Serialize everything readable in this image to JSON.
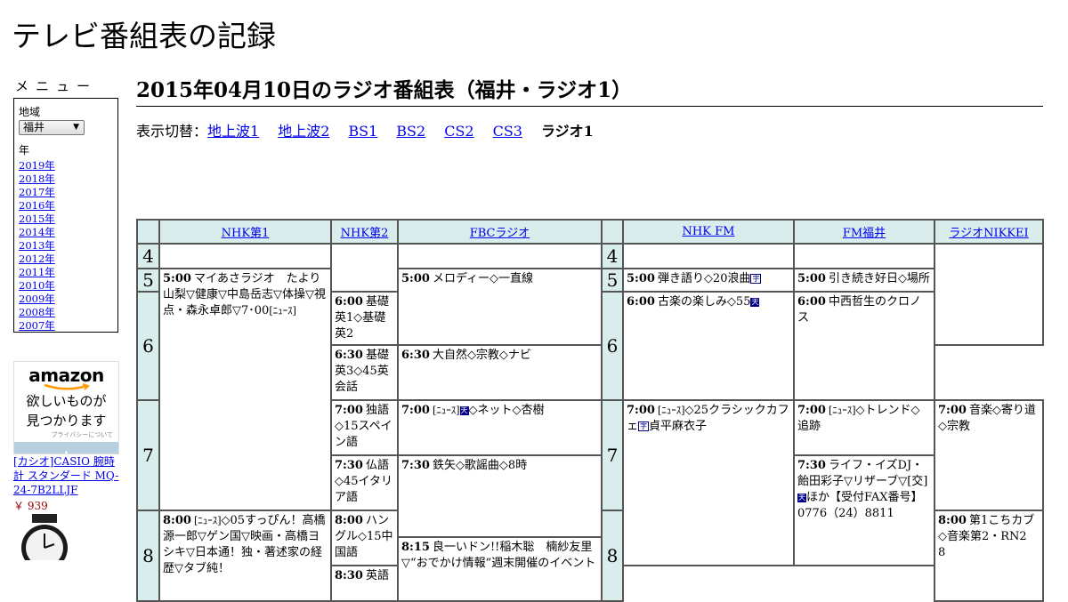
{
  "site": {
    "title": "テレビ番組表の記録"
  },
  "menu": {
    "title": "メニュー",
    "region_label": "地域",
    "region_value": "福井",
    "year_label": "年",
    "years": [
      "2019年",
      "2018年",
      "2017年",
      "2016年",
      "2015年",
      "2014年",
      "2013年",
      "2012年",
      "2011年",
      "2010年",
      "2009年",
      "2008年",
      "2007年"
    ]
  },
  "ad": {
    "logo": "amazon",
    "line1": "欲しいものが",
    "line2": "見つかります",
    "privacy": "プライバシーについて",
    "product_title": "[カシオ]CASIO 腕時計 スタンダード MQ-24-7B2LLJF",
    "price": "￥ 939"
  },
  "page": {
    "heading": "2015年04月10日のラジオ番組表（福井・ラジオ1）"
  },
  "switcher": {
    "label": "表示切替：",
    "links": [
      "地上波1",
      "地上波2",
      "BS1",
      "BS2",
      "CS2",
      "CS3"
    ],
    "current": "ラジオ1"
  },
  "schedule": {
    "channels": [
      "NHK第1",
      "NHK第2",
      "FBCラジオ",
      "NHK FM",
      "FM福井",
      "ラジオNIKKEI"
    ],
    "hours": [
      "4",
      "5",
      "6",
      "7",
      "8"
    ],
    "programs": {
      "nhk1_0500": {
        "time": "5:00",
        "text": "マイあさラジオ　たより山梨▽健康▽中島岳志▽体操▽視点・森永卓郎▽7･00",
        "tag": "[ﾆｭｰｽ]"
      },
      "nhk1_0800": {
        "time": "8:00",
        "tag": "[ﾆｭｰｽ]",
        "text": "◇05すっぴん！高橋源一郎▽ゲン国▽映画・高橋ヨシキ▽日本通！独・著述家の経歴▽タブ純！"
      },
      "nhk2_0600": {
        "time": "6:00",
        "text": "基礎英1◇基礎英2"
      },
      "nhk2_0630": {
        "time": "6:30",
        "text": "基礎英3◇45英会話"
      },
      "nhk2_0700": {
        "time": "7:00",
        "text": "独語◇15スペイン語"
      },
      "nhk2_0730": {
        "time": "7:30",
        "text": "仏語◇45イタリア語"
      },
      "nhk2_0800": {
        "time": "8:00",
        "text": "ハングル◇15中国語"
      },
      "nhk2_0830": {
        "time": "8:30",
        "text": "英語"
      },
      "fbc_0500": {
        "time": "5:00",
        "text": "メロディー◇一直線"
      },
      "fbc_0630": {
        "time": "6:30",
        "text": "大自然◇宗教◇ナビ"
      },
      "fbc_0700": {
        "time": "7:00",
        "tag": "[ﾆｭｰｽ]",
        "mark": "天",
        "text": "◇ネット◇杏樹"
      },
      "fbc_0730": {
        "time": "7:30",
        "text": "鉄矢◇歌謡曲◇8時"
      },
      "fbc_0815": {
        "time": "8:15",
        "text": "良一いドン!!稲木聡　楠紗友里▽“おでかけ情報”週末開催のイベント"
      },
      "nhkfm_0500": {
        "time": "5:00",
        "text": "弾き語り◇20浪曲",
        "mark": "字"
      },
      "nhkfm_0600": {
        "time": "6:00",
        "text": "古楽の楽しみ◇55",
        "mark": "天"
      },
      "nhkfm_0700": {
        "time": "7:00",
        "tag": "[ﾆｭｰｽ]",
        "text": "◇25クラシックカフェ",
        "mark": "字",
        "text2": "貞平麻衣子"
      },
      "fmf_0500": {
        "time": "5:00",
        "text": "引き続き好日◇場所"
      },
      "fmf_0600": {
        "time": "6:00",
        "text": "中西哲生のクロノス"
      },
      "fmf_0700": {
        "time": "7:00",
        "tag": "[ﾆｭｰｽ]",
        "text": "◇トレンド◇追跡"
      },
      "fmf_0730": {
        "time": "7:30",
        "text": "ライフ・イズDJ・飴田彩子▽リザーブ▽[交]",
        "mark": "天",
        "text2": "ほか【受付FAX番号】0776（24）8811"
      },
      "nikkei_0700": {
        "time": "7:00",
        "text": "音楽◇寄り道◇宗教"
      },
      "nikkei_0800": {
        "time": "8:00",
        "text": "第1こちカブ◇音楽第2・RN2　8"
      }
    }
  }
}
